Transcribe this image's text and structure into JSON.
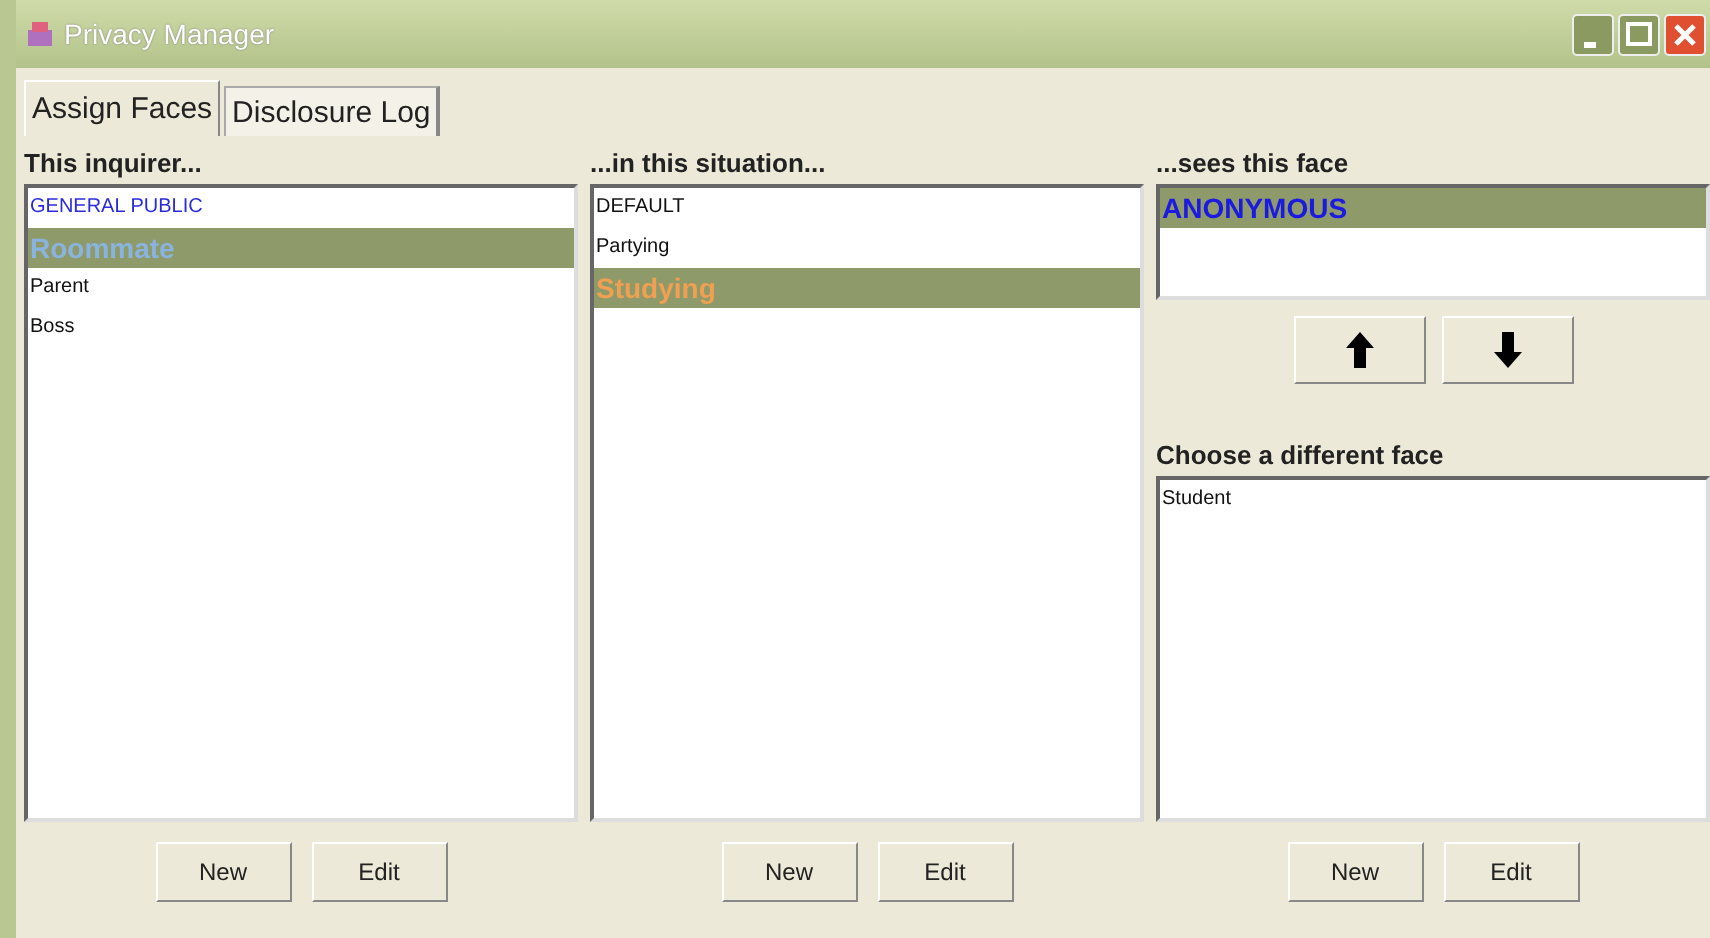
{
  "window": {
    "title": "Privacy Manager"
  },
  "tabs": [
    {
      "label": "Assign Faces",
      "selected": true
    },
    {
      "label": "Disclosure Log",
      "selected": false
    }
  ],
  "inquirers": {
    "heading": "This inquirer...",
    "items": [
      {
        "label": "GENERAL PUBLIC",
        "selected": false,
        "color": "#2a2ae0"
      },
      {
        "label": "Roommate",
        "selected": true,
        "color": "#8ab4e0"
      },
      {
        "label": "Parent",
        "selected": false,
        "color": "#111111"
      },
      {
        "label": "Boss",
        "selected": false,
        "color": "#111111"
      }
    ],
    "buttons": [
      "New",
      "Edit"
    ]
  },
  "situations": {
    "heading": "...in this situation...",
    "items": [
      {
        "label": "DEFAULT",
        "selected": false,
        "color": "#111111"
      },
      {
        "label": "Partying",
        "selected": false,
        "color": "#111111"
      },
      {
        "label": "Studying",
        "selected": true,
        "color": "#f0a050"
      }
    ],
    "buttons": [
      "New",
      "Edit"
    ]
  },
  "face": {
    "heading": "...sees this face",
    "items": [
      {
        "label": "ANONYMOUS",
        "selected": true,
        "color": "#1a1ae0"
      }
    ],
    "choose_heading": "Choose a different face",
    "choices": [
      {
        "label": "Student",
        "selected": false,
        "color": "#111111"
      }
    ],
    "buttons": [
      "New",
      "Edit"
    ]
  }
}
